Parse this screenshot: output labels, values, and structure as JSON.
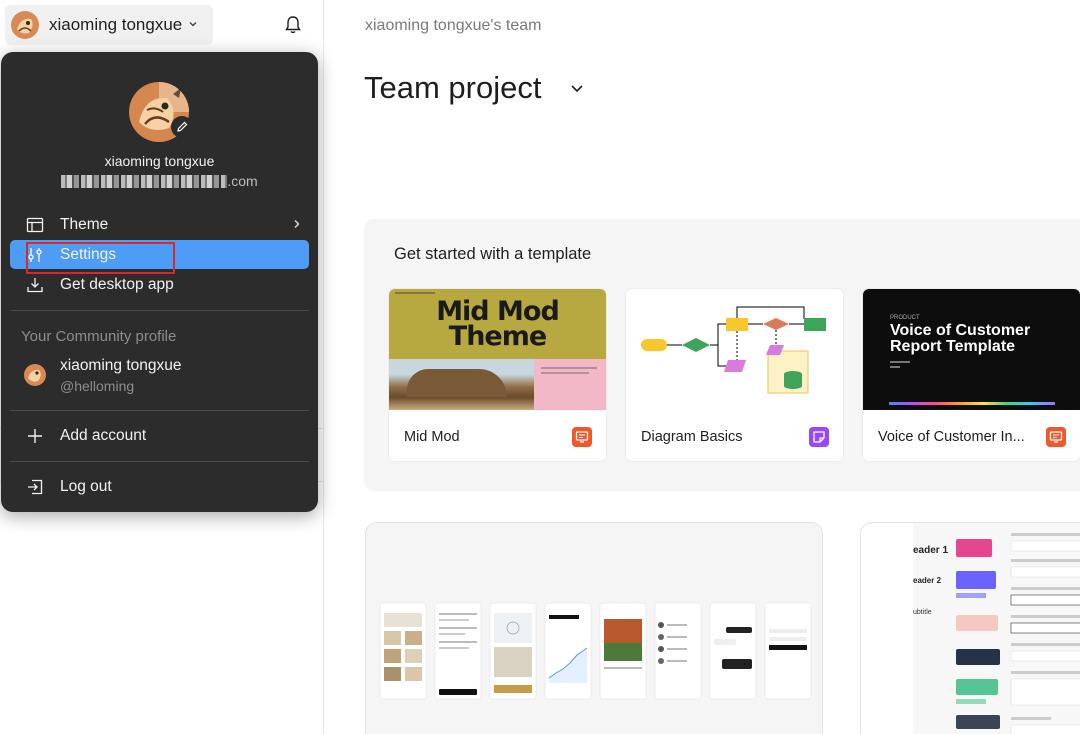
{
  "account": {
    "name": "xiaoming tongxue",
    "email_suffix": ".com"
  },
  "menu": {
    "items": [
      {
        "label": "Theme",
        "icon": "layout-icon",
        "submenu": true
      },
      {
        "label": "Settings",
        "icon": "sliders-icon",
        "active": true
      },
      {
        "label": "Get desktop app",
        "icon": "download-icon"
      }
    ],
    "community_label": "Your Community profile",
    "profile": {
      "name": "xiaoming tongxue",
      "handle": "@helloming"
    },
    "add_account": "Add account",
    "logout": "Log out"
  },
  "main": {
    "team": "xiaoming tongxue's team",
    "title": "Team project",
    "templates": {
      "heading": "Get started with a template",
      "cards": [
        {
          "label": "Mid Mod",
          "thumb_title_1": "Mid Mod",
          "thumb_title_2": "Theme",
          "badge_color": "#f0582b"
        },
        {
          "label": "Diagram Basics",
          "badge_color": "#9747ff"
        },
        {
          "label": "Voice of Customer In...",
          "thumb_title_1": "Voice of Customer",
          "thumb_title_2": "Report Template",
          "badge_color": "#f0582b"
        }
      ]
    },
    "file_preview": {
      "rows": [
        "eader 1",
        "eader 2",
        "ubtitle"
      ]
    }
  },
  "colors": {
    "accent": "#4d9cf5",
    "menu_bg": "#2c2c2c",
    "highlight": "#d9282a"
  }
}
